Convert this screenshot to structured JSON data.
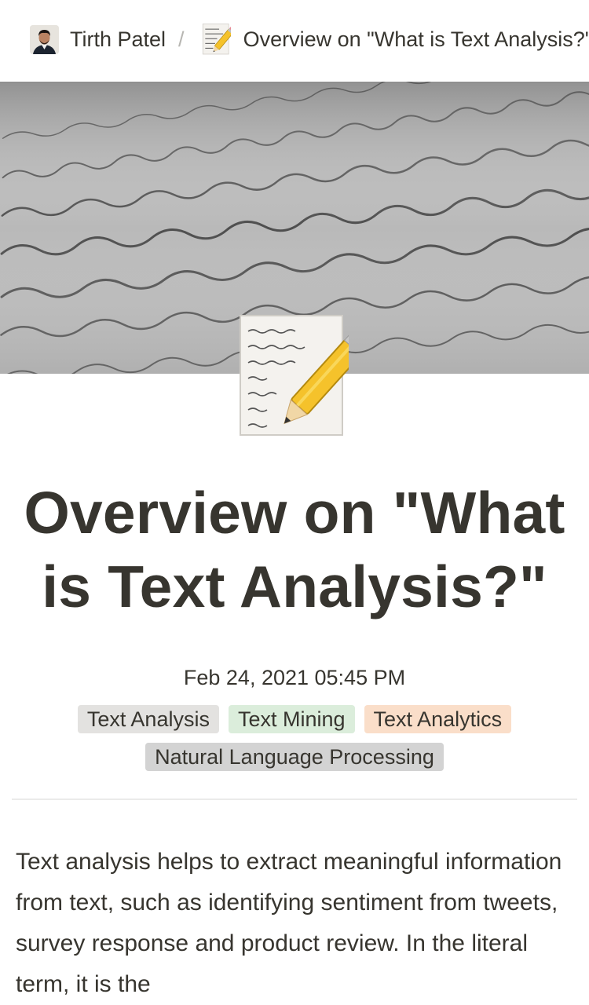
{
  "breadcrumb": {
    "author": "Tirth Patel",
    "separator": "/",
    "page_title": "Overview on \"What is Text Analysis?\""
  },
  "page": {
    "title": "Overview on \"What is Text Analysis?\"",
    "date": "Feb 24, 2021 05:45 PM",
    "tags": [
      {
        "label": "Text Analysis",
        "color": "#e3e2e0"
      },
      {
        "label": "Text Mining",
        "color": "#dbeddb"
      },
      {
        "label": "Text Analytics",
        "color": "#fadec9"
      },
      {
        "label": "Natural Language Processing",
        "color": "#d3d3d3"
      }
    ],
    "body": "Text analysis helps to extract meaningful information from text, such as identifying sentiment from tweets, survey response and product review. In the literal term, it is the"
  },
  "icons": {
    "avatar": "user-avatar",
    "page_icon": "memo-pencil-icon",
    "cover": "handwriting-cover-image"
  }
}
